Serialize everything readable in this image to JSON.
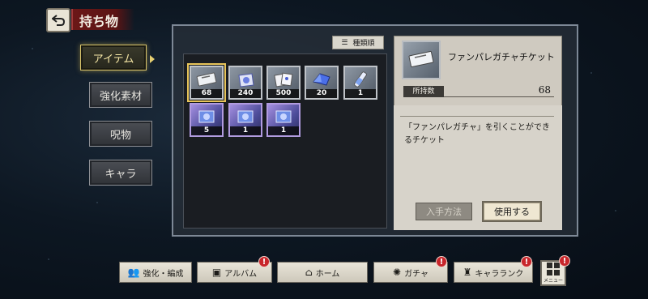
{
  "header": {
    "title": "持ち物"
  },
  "tabs": [
    {
      "label": "アイテム",
      "active": true
    },
    {
      "label": "強化素材",
      "active": false
    },
    {
      "label": "呪物",
      "active": false
    },
    {
      "label": "キャラ",
      "active": false
    }
  ],
  "sort": {
    "label": "種類順",
    "icon": "list-icon"
  },
  "items": [
    {
      "name": "ticket",
      "count": "68",
      "rarity": "silver",
      "selected": true
    },
    {
      "name": "crystal-bag",
      "count": "240",
      "rarity": "silver"
    },
    {
      "name": "cards",
      "count": "500",
      "rarity": "silver"
    },
    {
      "name": "blue-crystal",
      "count": "20",
      "rarity": "silver"
    },
    {
      "name": "potion-tube",
      "count": "1",
      "rarity": "silver"
    },
    {
      "name": "card-pack-a",
      "count": "5",
      "rarity": "purple"
    },
    {
      "name": "card-pack-b",
      "count": "1",
      "rarity": "purple"
    },
    {
      "name": "card-pack-c",
      "count": "1",
      "rarity": "purple"
    }
  ],
  "detail": {
    "name": "ファンパレガチャチケット",
    "owned_label": "所持数",
    "owned_value": "68",
    "description_line1": "「ファンパレガチャ」を引くことができ",
    "description_line2": "るチケット",
    "acquire_label": "入手方法",
    "use_label": "使用する"
  },
  "bottom_nav": [
    {
      "label": "強化・編成",
      "icon": "team-icon",
      "badge": ""
    },
    {
      "label": "アルバム",
      "icon": "album-icon",
      "badge": "!"
    },
    {
      "label": "ホーム",
      "icon": "home-icon",
      "badge": ""
    },
    {
      "label": "ガチャ",
      "icon": "gacha-icon",
      "badge": "!"
    },
    {
      "label": "キャラランク",
      "icon": "rank-icon",
      "badge": "!"
    }
  ],
  "menu": {
    "label": "メニュー",
    "badge": "!"
  },
  "colors": {
    "accent_gold": "#e7c45a",
    "badge_red": "#c8262b",
    "title_red": "#6b1717"
  }
}
